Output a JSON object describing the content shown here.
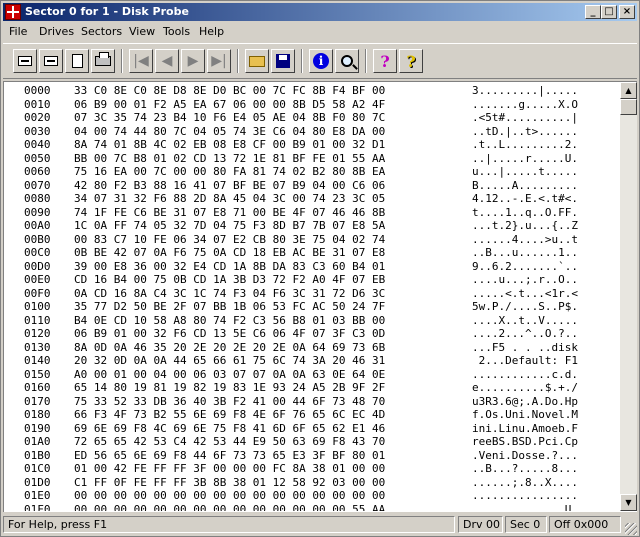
{
  "window": {
    "title": "Sector 0 for 1 - Disk Probe",
    "min_label": "_",
    "max_label": "□",
    "close_label": "×"
  },
  "menu": [
    "File",
    "Drives",
    "Sectors",
    "View",
    "Tools",
    "Help"
  ],
  "toolbar": {
    "icons": [
      "read-sector-icon",
      "write-sector-icon",
      "copy-page-icon",
      "print-icon",
      "first-sector-icon",
      "prev-sector-icon",
      "next-sector-icon",
      "last-sector-icon",
      "open-folder-icon",
      "save-disk-icon",
      "info-icon",
      "search-icon",
      "help-icon",
      "context-help-icon"
    ]
  },
  "hex_rows": [
    {
      "offset": "0000",
      "bytes": "33 C0 8E C0 8E D8 8E D0 BC 00 7C FC 8B F4 BF 00",
      "ascii": "3.........|....."
    },
    {
      "offset": "0010",
      "bytes": "06 B9 00 01 F2 A5 EA 67 06 00 00 8B D5 58 A2 4F",
      "ascii": ".......g.....X.O"
    },
    {
      "offset": "0020",
      "bytes": "07 3C 35 74 23 B4 10 F6 E4 05 AE 04 8B F0 80 7C",
      "ascii": ".<5t#..........|"
    },
    {
      "offset": "0030",
      "bytes": "04 00 74 44 80 7C 04 05 74 3E C6 04 80 E8 DA 00",
      "ascii": "..tD.|..t>......"
    },
    {
      "offset": "0040",
      "bytes": "8A 74 01 8B 4C 02 EB 08 E8 CF 00 B9 01 00 32 D1",
      "ascii": ".t..L.........2."
    },
    {
      "offset": "0050",
      "bytes": "BB 00 7C B8 01 02 CD 13 72 1E 81 BF FE 01 55 AA",
      "ascii": "..|.....r.....U."
    },
    {
      "offset": "0060",
      "bytes": "75 16 EA 00 7C 00 00 80 FA 81 74 02 B2 80 8B EA",
      "ascii": "u...|.....t....."
    },
    {
      "offset": "0070",
      "bytes": "42 80 F2 B3 88 16 41 07 BF BE 07 B9 04 00 C6 06",
      "ascii": "B.....A........."
    },
    {
      "offset": "0080",
      "bytes": "34 07 31 32 F6 88 2D 8A 45 04 3C 00 74 23 3C 05",
      "ascii": "4.12..-.E.<.t#<."
    },
    {
      "offset": "0090",
      "bytes": "74 1F FE C6 BE 31 07 E8 71 00 BE 4F 07 46 46 8B",
      "ascii": "t....1..q..O.FF."
    },
    {
      "offset": "00A0",
      "bytes": "1C 0A FF 74 05 32 7D 04 75 F3 8D B7 7B 07 E8 5A",
      "ascii": "...t.2}.u...{..Z"
    },
    {
      "offset": "00B0",
      "bytes": "00 83 C7 10 FE 06 34 07 E2 CB 80 3E 75 04 02 74",
      "ascii": "......4....>u..t"
    },
    {
      "offset": "00C0",
      "bytes": "0B BE 42 07 0A F6 75 0A CD 18 EB AC BE 31 07 E8",
      "ascii": "..B...u......1.."
    },
    {
      "offset": "00D0",
      "bytes": "39 00 E8 36 00 32 E4 CD 1A 8B DA 83 C3 60 B4 01",
      "ascii": "9..6.2.......`.."
    },
    {
      "offset": "00E0",
      "bytes": "CD 16 B4 00 75 0B CD 1A 3B D3 72 F2 A0 4F 07 EB",
      "ascii": "....u...;.r..O.."
    },
    {
      "offset": "00F0",
      "bytes": "0A CD 16 8A C4 3C 1C 74 F3 04 F6 3C 31 72 D6 3C",
      "ascii": ".....<.t...<1r.<"
    },
    {
      "offset": "0100",
      "bytes": "35 77 D2 50 BE 2F 07 BB 1B 06 53 FC AC 50 24 7F",
      "ascii": "5w.P./....S..P$."
    },
    {
      "offset": "0110",
      "bytes": "B4 0E CD 10 58 A8 80 74 F2 C3 56 B8 01 03 BB 00",
      "ascii": "....X..t..V....."
    },
    {
      "offset": "0120",
      "bytes": "06 B9 01 00 32 F6 CD 13 5E C6 06 4F 07 3F C3 0D",
      "ascii": "....2...^..O.?.."
    },
    {
      "offset": "0130",
      "bytes": "8A 0D 0A 46 35 20 2E 20 2E 20 2E 0A 64 69 73 6B",
      "ascii": "...F5 . . ..disk"
    },
    {
      "offset": "0140",
      "bytes": "20 32 0D 0A 0A 44 65 66 61 75 6C 74 3A 20 46 31",
      "ascii": " 2...Default: F1"
    },
    {
      "offset": "0150",
      "bytes": "A0 00 01 00 04 00 06 03 07 07 0A 0A 63 0E 64 0E",
      "ascii": "............c.d."
    },
    {
      "offset": "0160",
      "bytes": "65 14 80 19 81 19 82 19 83 1E 93 24 A5 2B 9F 2F",
      "ascii": "e..........$.+./"
    },
    {
      "offset": "0170",
      "bytes": "75 33 52 33 DB 36 40 3B F2 41 00 44 6F 73 48 70",
      "ascii": "u3R3.6@;.A.Do.Hp"
    },
    {
      "offset": "0180",
      "bytes": "66 F3 4F 73 B2 55 6E 69 F8 4E 6F 76 65 6C EC 4D",
      "ascii": "f.Os.Uni.Novel.M"
    },
    {
      "offset": "0190",
      "bytes": "69 6E 69 F8 4C 69 6E 75 F8 41 6D 6F 65 62 E1 46",
      "ascii": "ini.Linu.Amoeb.F"
    },
    {
      "offset": "01A0",
      "bytes": "72 65 65 42 53 C4 42 53 44 E9 50 63 69 F8 43 70",
      "ascii": "reeBS.BSD.Pci.Cp"
    },
    {
      "offset": "01B0",
      "bytes": "ED 56 65 6E 69 F8 44 6F 73 73 65 E3 3F BF 80 01",
      "ascii": ".Veni.Dosse.?..."
    },
    {
      "offset": "01C0",
      "bytes": "01 00 42 FE FF FF 3F 00 00 00 FC 8A 38 01 00 00",
      "ascii": "..B...?.....8..."
    },
    {
      "offset": "01D0",
      "bytes": "C1 FF 0F FE FF FF 3B 8B 38 01 12 58 92 03 00 00",
      "ascii": "......;.8..X...."
    },
    {
      "offset": "01E0",
      "bytes": "00 00 00 00 00 00 00 00 00 00 00 00 00 00 00 00",
      "ascii": "................"
    },
    {
      "offset": "01F0",
      "bytes": "00 00 00 00 00 00 00 00 00 00 00 00 00 00 55 AA",
      "ascii": "..............U."
    }
  ],
  "status": {
    "help_text": "For Help, press F1",
    "drive": "Drv  00",
    "sector": "Sec 0",
    "offset": "Off 0x000"
  }
}
